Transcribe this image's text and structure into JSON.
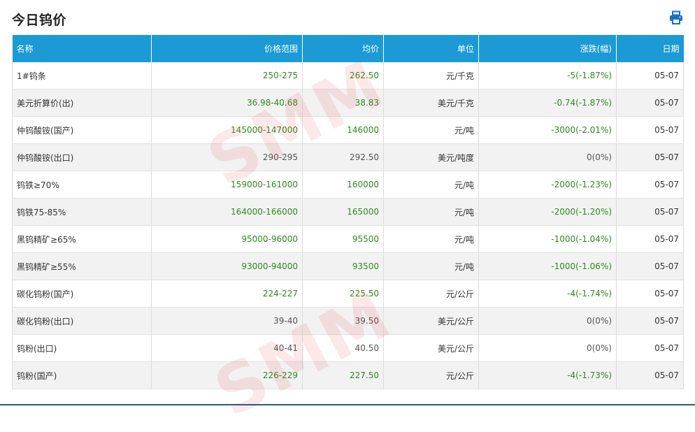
{
  "page": {
    "title": "今日钨价"
  },
  "colors": {
    "header_bg": "#1b9ad6",
    "up": "#2e8b1f",
    "neutral": "#555555"
  },
  "icons": {
    "print": "print-icon"
  },
  "watermark": "SMM",
  "table": {
    "columns": [
      "名称",
      "价格范围",
      "均价",
      "单位",
      "涨跌(幅)",
      "日期"
    ],
    "rows": [
      {
        "name": "1#钨条",
        "range": "250-275",
        "avg": "262.50",
        "unit": "元/千克",
        "change": "-5(-1.87%)",
        "date": "05-07",
        "trend": "green"
      },
      {
        "name": "美元折算价(出)",
        "range": "36.98-40.68",
        "avg": "38.83",
        "unit": "美元/千克",
        "change": "-0.74(-1.87%)",
        "date": "05-07",
        "trend": "green"
      },
      {
        "name": "仲钨酸铵(国产)",
        "range": "145000-147000",
        "avg": "146000",
        "unit": "元/吨",
        "change": "-3000(-2.01%)",
        "date": "05-07",
        "trend": "green"
      },
      {
        "name": "仲钨酸铵(出口)",
        "range": "290-295",
        "avg": "292.50",
        "unit": "美元/吨度",
        "change": "0(0%)",
        "date": "05-07",
        "trend": "gray"
      },
      {
        "name": "钨铁≥70%",
        "range": "159000-161000",
        "avg": "160000",
        "unit": "元/吨",
        "change": "-2000(-1.23%)",
        "date": "05-07",
        "trend": "green"
      },
      {
        "name": "钨铁75-85%",
        "range": "164000-166000",
        "avg": "165000",
        "unit": "元/吨",
        "change": "-2000(-1.20%)",
        "date": "05-07",
        "trend": "green"
      },
      {
        "name": "黑钨精矿≥65%",
        "range": "95000-96000",
        "avg": "95500",
        "unit": "元/吨",
        "change": "-1000(-1.04%)",
        "date": "05-07",
        "trend": "green"
      },
      {
        "name": "黑钨精矿≥55%",
        "range": "93000-94000",
        "avg": "93500",
        "unit": "元/吨",
        "change": "-1000(-1.06%)",
        "date": "05-07",
        "trend": "green"
      },
      {
        "name": "碳化钨粉(国产)",
        "range": "224-227",
        "avg": "225.50",
        "unit": "元/公斤",
        "change": "-4(-1.74%)",
        "date": "05-07",
        "trend": "green"
      },
      {
        "name": "碳化钨粉(出口)",
        "range": "39-40",
        "avg": "39.50",
        "unit": "美元/公斤",
        "change": "0(0%)",
        "date": "05-07",
        "trend": "gray"
      },
      {
        "name": "钨粉(出口)",
        "range": "40-41",
        "avg": "40.50",
        "unit": "美元/公斤",
        "change": "0(0%)",
        "date": "05-07",
        "trend": "gray"
      },
      {
        "name": "钨粉(国产)",
        "range": "226-229",
        "avg": "227.50",
        "unit": "元/公斤",
        "change": "-4(-1.73%)",
        "date": "05-07",
        "trend": "green"
      }
    ]
  }
}
